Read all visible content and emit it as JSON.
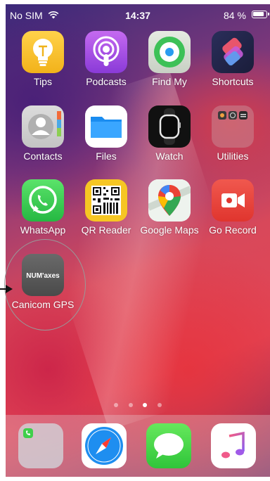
{
  "status_bar": {
    "carrier": "No SIM",
    "time": "14:37",
    "battery": "84 %"
  },
  "apps": [
    {
      "label": "Tips",
      "icon": "lightbulb-icon"
    },
    {
      "label": "Podcasts",
      "icon": "podcasts-icon"
    },
    {
      "label": "Find My",
      "icon": "find-my-icon"
    },
    {
      "label": "Shortcuts",
      "icon": "shortcuts-icon"
    },
    {
      "label": "Contacts",
      "icon": "contacts-icon"
    },
    {
      "label": "Files",
      "icon": "folder-icon"
    },
    {
      "label": "Watch",
      "icon": "watch-icon"
    },
    {
      "label": "Utilities",
      "icon": "folder-icon"
    },
    {
      "label": "WhatsApp",
      "icon": "whatsapp-icon"
    },
    {
      "label": "QR Reader",
      "icon": "qr-code-icon"
    },
    {
      "label": "Google Maps",
      "icon": "map-pin-icon"
    },
    {
      "label": "Go Record",
      "icon": "video-camera-icon"
    },
    {
      "label": "Canicom GPS",
      "icon": "numaxes-logo-icon",
      "logo_text": "NUM'axes"
    }
  ],
  "page_indicator": {
    "count": 4,
    "active_index": 2
  },
  "dock": [
    {
      "icon": "phone-folder-icon"
    },
    {
      "icon": "safari-icon"
    },
    {
      "icon": "messages-icon"
    },
    {
      "icon": "music-icon"
    }
  ],
  "annotation": {
    "highlight": "circle",
    "pointer": "arrow"
  }
}
